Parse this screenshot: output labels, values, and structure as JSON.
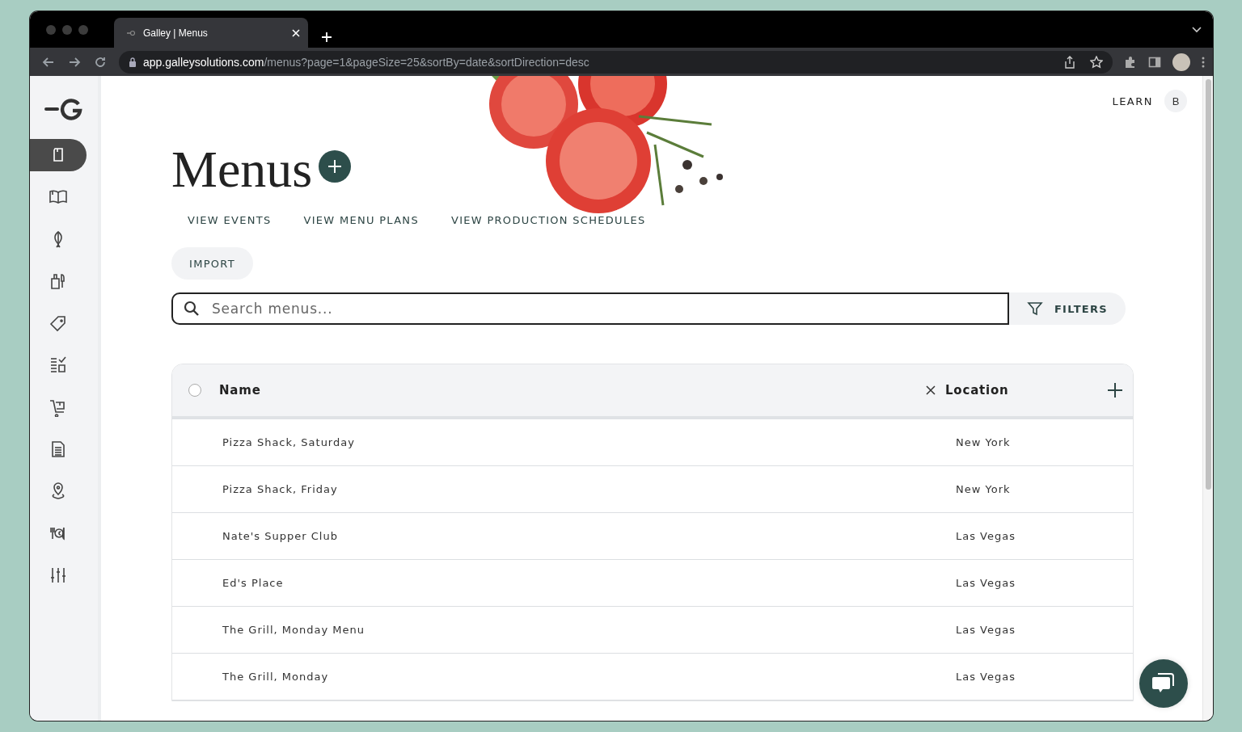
{
  "browser": {
    "tab_title": "Galley | Menus",
    "url_host": "app.galleysolutions.com",
    "url_path": "/menus?page=1&pageSize=25&sortBy=date&sortDirection=desc"
  },
  "sidebar": {
    "items": [
      {
        "selected": true
      },
      {
        "selected": false
      },
      {
        "selected": false
      },
      {
        "selected": false
      },
      {
        "selected": false
      },
      {
        "selected": false
      },
      {
        "selected": false
      },
      {
        "selected": false
      },
      {
        "selected": false
      },
      {
        "selected": false
      },
      {
        "selected": false
      }
    ]
  },
  "topbar": {
    "learn": "LEARN",
    "avatar": "B"
  },
  "title": "Menus",
  "links": [
    "VIEW EVENTS",
    "VIEW MENU PLANS",
    "VIEW PRODUCTION SCHEDULES"
  ],
  "import_button": "IMPORT",
  "search": {
    "placeholder": "Search menus..."
  },
  "filters_button": "FILTERS",
  "table": {
    "select_all": {
      "checked": false
    },
    "columns": [
      "Name",
      "Location"
    ],
    "rows": [
      {
        "name": "Pizza Shack, Saturday",
        "location": "New York"
      },
      {
        "name": "Pizza Shack, Friday",
        "location": "New York"
      },
      {
        "name": "Nate's Supper Club",
        "location": "Las Vegas"
      },
      {
        "name": "Ed's Place",
        "location": "Las Vegas"
      },
      {
        "name": "The Grill, Monday Menu",
        "location": "Las Vegas"
      },
      {
        "name": "The Grill, Monday",
        "location": "Las Vegas"
      }
    ]
  }
}
